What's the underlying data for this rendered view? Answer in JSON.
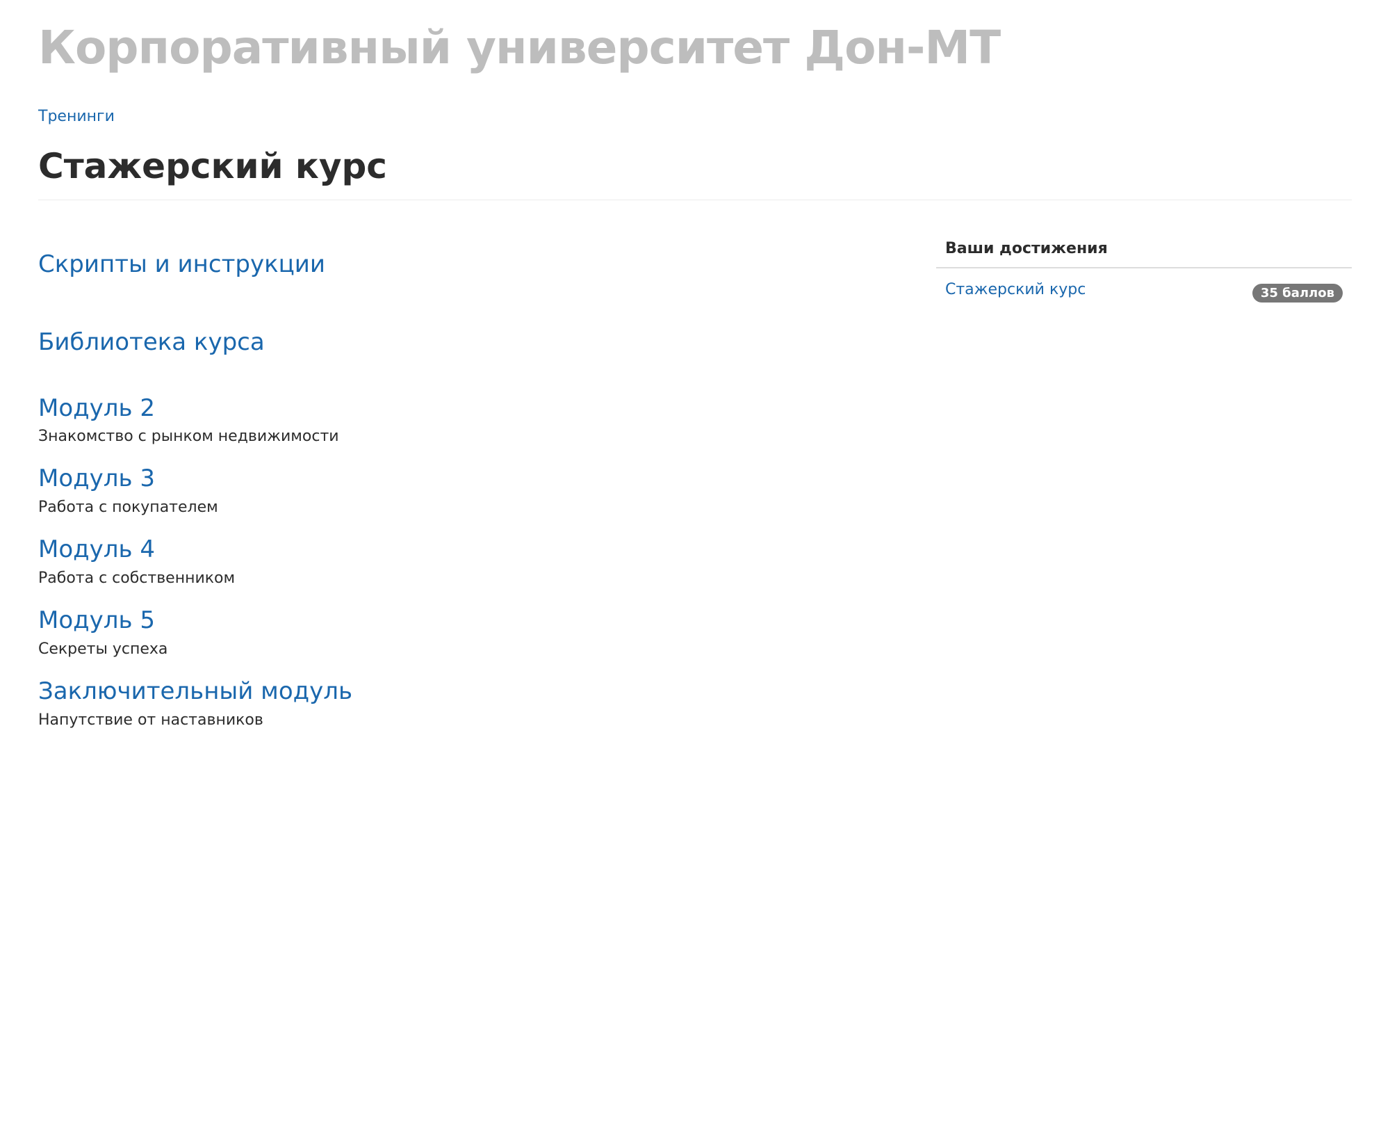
{
  "header": {
    "site_title": "Корпоративный университет Дон-МТ"
  },
  "breadcrumb": {
    "item": "Тренинги"
  },
  "page": {
    "title": "Стажерский курс"
  },
  "sections": [
    {
      "title": "Скрипты и инструкции",
      "subtitle": ""
    },
    {
      "title": "Библиотека курса",
      "subtitle": ""
    },
    {
      "title": "Модуль 2",
      "subtitle": "Знакомство с рынком недвижимости"
    },
    {
      "title": "Модуль 3",
      "subtitle": "Работа с покупателем"
    },
    {
      "title": "Модуль 4",
      "subtitle": "Работа с собственником"
    },
    {
      "title": "Модуль 5",
      "subtitle": "Секреты успеха"
    },
    {
      "title": "Заключительный модуль",
      "subtitle": "Напутствие от наставников"
    }
  ],
  "sidebar": {
    "heading": "Ваши достижения",
    "achievements": [
      {
        "course": "Стажерский курс",
        "points": "35 баллов"
      }
    ]
  },
  "colors": {
    "link": "#1a67ad",
    "site_title": "#bdbdbd",
    "badge": "#777777"
  }
}
